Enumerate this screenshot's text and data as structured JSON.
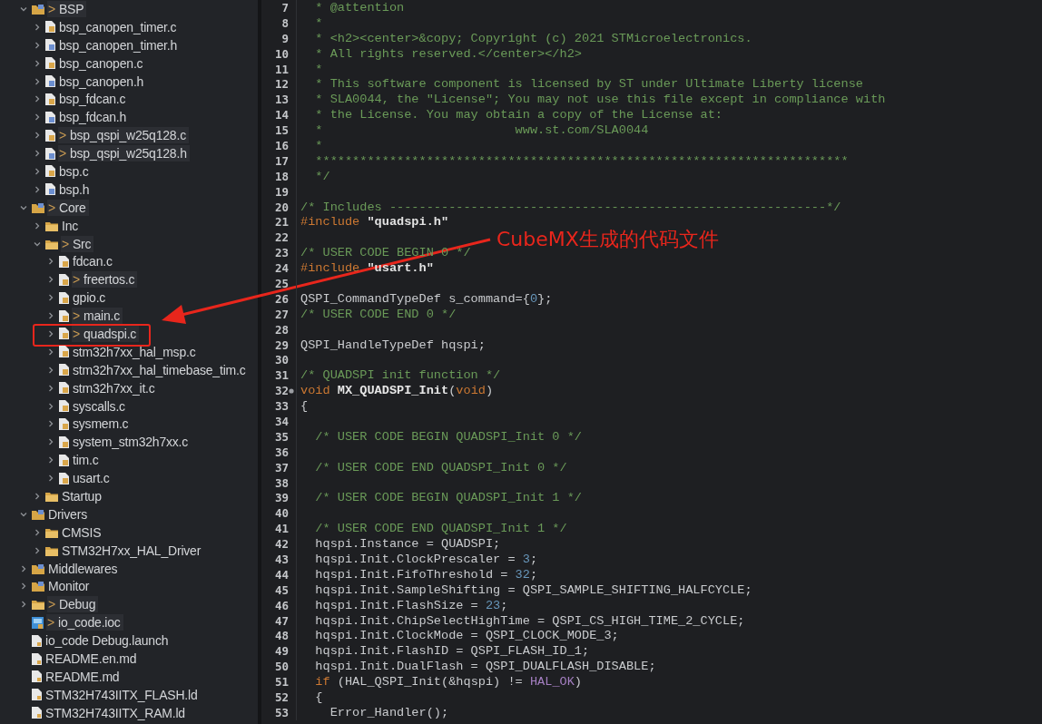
{
  "project_tree": [
    {
      "label": "BSP",
      "kind": "project",
      "marker": ">",
      "expanded": true,
      "children": [
        {
          "label": "bsp_canopen_timer.c",
          "kind": "c-file",
          "expanded": false
        },
        {
          "label": "bsp_canopen_timer.h",
          "kind": "h-file",
          "expanded": false
        },
        {
          "label": "bsp_canopen.c",
          "kind": "c-file",
          "expanded": false
        },
        {
          "label": "bsp_canopen.h",
          "kind": "h-file",
          "expanded": false
        },
        {
          "label": "bsp_fdcan.c",
          "kind": "c-file",
          "expanded": false
        },
        {
          "label": "bsp_fdcan.h",
          "kind": "h-file",
          "expanded": false
        },
        {
          "label": "bsp_qspi_w25q128.c",
          "kind": "c-file",
          "marker": ">",
          "expanded": false
        },
        {
          "label": "bsp_qspi_w25q128.h",
          "kind": "h-file",
          "marker": ">",
          "expanded": false
        },
        {
          "label": "bsp.c",
          "kind": "c-file",
          "expanded": false
        },
        {
          "label": "bsp.h",
          "kind": "h-file",
          "expanded": false
        }
      ]
    },
    {
      "label": "Core",
      "kind": "project",
      "marker": ">",
      "expanded": true,
      "children": [
        {
          "label": "Inc",
          "kind": "folder",
          "expanded": false
        },
        {
          "label": "Src",
          "kind": "folder",
          "marker": ">",
          "expanded": true,
          "children": [
            {
              "label": "fdcan.c",
              "kind": "c-file",
              "expanded": false
            },
            {
              "label": "freertos.c",
              "kind": "c-file",
              "marker": ">",
              "expanded": false
            },
            {
              "label": "gpio.c",
              "kind": "c-file",
              "expanded": false
            },
            {
              "label": "main.c",
              "kind": "c-file",
              "marker": ">",
              "expanded": false
            },
            {
              "label": "quadspi.c",
              "kind": "c-file",
              "marker": ">",
              "expanded": false,
              "annotated": true
            },
            {
              "label": "stm32h7xx_hal_msp.c",
              "kind": "c-file",
              "expanded": false
            },
            {
              "label": "stm32h7xx_hal_timebase_tim.c",
              "kind": "c-file",
              "expanded": false
            },
            {
              "label": "stm32h7xx_it.c",
              "kind": "c-file",
              "expanded": false
            },
            {
              "label": "syscalls.c",
              "kind": "c-file",
              "expanded": false
            },
            {
              "label": "sysmem.c",
              "kind": "c-file",
              "expanded": false
            },
            {
              "label": "system_stm32h7xx.c",
              "kind": "c-file",
              "expanded": false
            },
            {
              "label": "tim.c",
              "kind": "c-file",
              "expanded": false
            },
            {
              "label": "usart.c",
              "kind": "c-file",
              "expanded": false
            }
          ]
        },
        {
          "label": "Startup",
          "kind": "folder",
          "expanded": false
        }
      ]
    },
    {
      "label": "Drivers",
      "kind": "project",
      "expanded": true,
      "children": [
        {
          "label": "CMSIS",
          "kind": "folder",
          "expanded": false
        },
        {
          "label": "STM32H7xx_HAL_Driver",
          "kind": "folder",
          "expanded": false
        }
      ]
    },
    {
      "label": "Middlewares",
      "kind": "project",
      "expanded": false
    },
    {
      "label": "Monitor",
      "kind": "project",
      "expanded": false
    },
    {
      "label": "Debug",
      "kind": "folder",
      "marker": ">",
      "expanded": false
    },
    {
      "label": "io_code.ioc",
      "kind": "ioc",
      "marker": ">"
    },
    {
      "label": "io_code Debug.launch",
      "kind": "file"
    },
    {
      "label": "README.en.md",
      "kind": "file"
    },
    {
      "label": "README.md",
      "kind": "file"
    },
    {
      "label": "STM32H743IITX_FLASH.ld",
      "kind": "file"
    },
    {
      "label": "STM32H743IITX_RAM.ld",
      "kind": "file"
    }
  ],
  "annotation": {
    "caption": "CubeMX生成的代码文件"
  },
  "editor_lines": [
    {
      "number": "7",
      "tokens": [
        {
          "kind": "comment",
          "text": "  * @attention"
        }
      ]
    },
    {
      "number": "8",
      "tokens": [
        {
          "kind": "comment",
          "text": "  *"
        }
      ]
    },
    {
      "number": "9",
      "tokens": [
        {
          "kind": "comment",
          "text": "  * <h2><center>&copy; Copyright (c) 2021 STMicroelectronics."
        }
      ]
    },
    {
      "number": "10",
      "tokens": [
        {
          "kind": "comment",
          "text": "  * All rights reserved.</center></h2>"
        }
      ]
    },
    {
      "number": "11",
      "tokens": [
        {
          "kind": "comment",
          "text": "  *"
        }
      ]
    },
    {
      "number": "12",
      "tokens": [
        {
          "kind": "comment",
          "text": "  * This software component is licensed by ST under Ultimate Liberty license"
        }
      ]
    },
    {
      "number": "13",
      "tokens": [
        {
          "kind": "comment",
          "text": "  * SLA0044, the \"License\"; You may not use this file except in compliance with"
        }
      ]
    },
    {
      "number": "14",
      "tokens": [
        {
          "kind": "comment",
          "text": "  * the License. You may obtain a copy of the License at:"
        }
      ]
    },
    {
      "number": "15",
      "tokens": [
        {
          "kind": "comment",
          "text": "  *                          www.st.com/SLA0044"
        }
      ]
    },
    {
      "number": "16",
      "tokens": [
        {
          "kind": "comment",
          "text": "  *"
        }
      ]
    },
    {
      "number": "17",
      "tokens": [
        {
          "kind": "comment",
          "text": "  ************************************************************************"
        }
      ]
    },
    {
      "number": "18",
      "tokens": [
        {
          "kind": "comment",
          "text": "  */"
        }
      ]
    },
    {
      "number": "19"
    },
    {
      "number": "20",
      "tokens": [
        {
          "kind": "comment",
          "text": "/* Includes -----------------------------------------------------------*/"
        }
      ]
    },
    {
      "number": "21",
      "tokens": [
        {
          "kind": "keyword",
          "text": "#include "
        },
        {
          "kind": "string",
          "text": "\"quadspi.h\""
        }
      ]
    },
    {
      "number": "22"
    },
    {
      "number": "23",
      "tokens": [
        {
          "kind": "comment",
          "text": "/* USER CODE BEGIN 0 */"
        }
      ]
    },
    {
      "number": "24",
      "tokens": [
        {
          "kind": "keyword",
          "text": "#include "
        },
        {
          "kind": "string",
          "text": "\"usart.h\""
        }
      ]
    },
    {
      "number": "25"
    },
    {
      "number": "26",
      "tokens": [
        {
          "kind": "plain",
          "text": "QSPI_CommandTypeDef s_command={"
        },
        {
          "kind": "number",
          "text": "0"
        },
        {
          "kind": "plain",
          "text": "};"
        }
      ]
    },
    {
      "number": "27",
      "tokens": [
        {
          "kind": "comment",
          "text": "/* USER CODE END 0 */"
        }
      ]
    },
    {
      "number": "28"
    },
    {
      "number": "29",
      "tokens": [
        {
          "kind": "plain",
          "text": "QSPI_HandleTypeDef hqspi;"
        }
      ]
    },
    {
      "number": "30"
    },
    {
      "number": "31",
      "tokens": [
        {
          "kind": "comment",
          "text": "/* QUADSPI init function */"
        }
      ]
    },
    {
      "number": "32",
      "foldable": true,
      "tokens": [
        {
          "kind": "keyword",
          "text": "void "
        },
        {
          "kind": "function",
          "text": "MX_QUADSPI_Init"
        },
        {
          "kind": "plain",
          "text": "("
        },
        {
          "kind": "keyword",
          "text": "void"
        },
        {
          "kind": "plain",
          "text": ")"
        }
      ]
    },
    {
      "number": "33",
      "tokens": [
        {
          "kind": "plain",
          "text": "{"
        }
      ]
    },
    {
      "number": "34"
    },
    {
      "number": "35",
      "tokens": [
        {
          "kind": "comment",
          "text": "  /* USER CODE BEGIN QUADSPI_Init 0 */"
        }
      ]
    },
    {
      "number": "36"
    },
    {
      "number": "37",
      "tokens": [
        {
          "kind": "comment",
          "text": "  /* USER CODE END QUADSPI_Init 0 */"
        }
      ]
    },
    {
      "number": "38"
    },
    {
      "number": "39",
      "tokens": [
        {
          "kind": "comment",
          "text": "  /* USER CODE BEGIN QUADSPI_Init 1 */"
        }
      ]
    },
    {
      "number": "40"
    },
    {
      "number": "41",
      "tokens": [
        {
          "kind": "comment",
          "text": "  /* USER CODE END QUADSPI_Init 1 */"
        }
      ]
    },
    {
      "number": "42",
      "tokens": [
        {
          "kind": "plain",
          "text": "  hqspi.Instance = QUADSPI;"
        }
      ]
    },
    {
      "number": "43",
      "tokens": [
        {
          "kind": "plain",
          "text": "  hqspi.Init.ClockPrescaler = "
        },
        {
          "kind": "number",
          "text": "3"
        },
        {
          "kind": "plain",
          "text": ";"
        }
      ]
    },
    {
      "number": "44",
      "tokens": [
        {
          "kind": "plain",
          "text": "  hqspi.Init.FifoThreshold = "
        },
        {
          "kind": "number",
          "text": "32"
        },
        {
          "kind": "plain",
          "text": ";"
        }
      ]
    },
    {
      "number": "45",
      "tokens": [
        {
          "kind": "plain",
          "text": "  hqspi.Init.SampleShifting = QSPI_SAMPLE_SHIFTING_HALFCYCLE;"
        }
      ]
    },
    {
      "number": "46",
      "tokens": [
        {
          "kind": "plain",
          "text": "  hqspi.Init.FlashSize = "
        },
        {
          "kind": "number",
          "text": "23"
        },
        {
          "kind": "plain",
          "text": ";"
        }
      ]
    },
    {
      "number": "47",
      "tokens": [
        {
          "kind": "plain",
          "text": "  hqspi.Init.ChipSelectHighTime = QSPI_CS_HIGH_TIME_2_CYCLE;"
        }
      ]
    },
    {
      "number": "48",
      "tokens": [
        {
          "kind": "plain",
          "text": "  hqspi.Init.ClockMode = QSPI_CLOCK_MODE_3;"
        }
      ]
    },
    {
      "number": "49",
      "tokens": [
        {
          "kind": "plain",
          "text": "  hqspi.Init.FlashID = QSPI_FLASH_ID_1;"
        }
      ]
    },
    {
      "number": "50",
      "tokens": [
        {
          "kind": "plain",
          "text": "  hqspi.Init.DualFlash = QSPI_DUALFLASH_DISABLE;"
        }
      ]
    },
    {
      "number": "51",
      "tokens": [
        {
          "kind": "keyword",
          "text": "  if"
        },
        {
          "kind": "plain",
          "text": " (HAL_QSPI_Init(&hqspi) != "
        },
        {
          "kind": "constant",
          "text": "HAL_OK"
        },
        {
          "kind": "plain",
          "text": ")"
        }
      ]
    },
    {
      "number": "52",
      "tokens": [
        {
          "kind": "plain",
          "text": "  {"
        }
      ]
    },
    {
      "number": "53",
      "tokens": [
        {
          "kind": "plain",
          "text": "    Error_Handler();"
        }
      ]
    }
  ]
}
